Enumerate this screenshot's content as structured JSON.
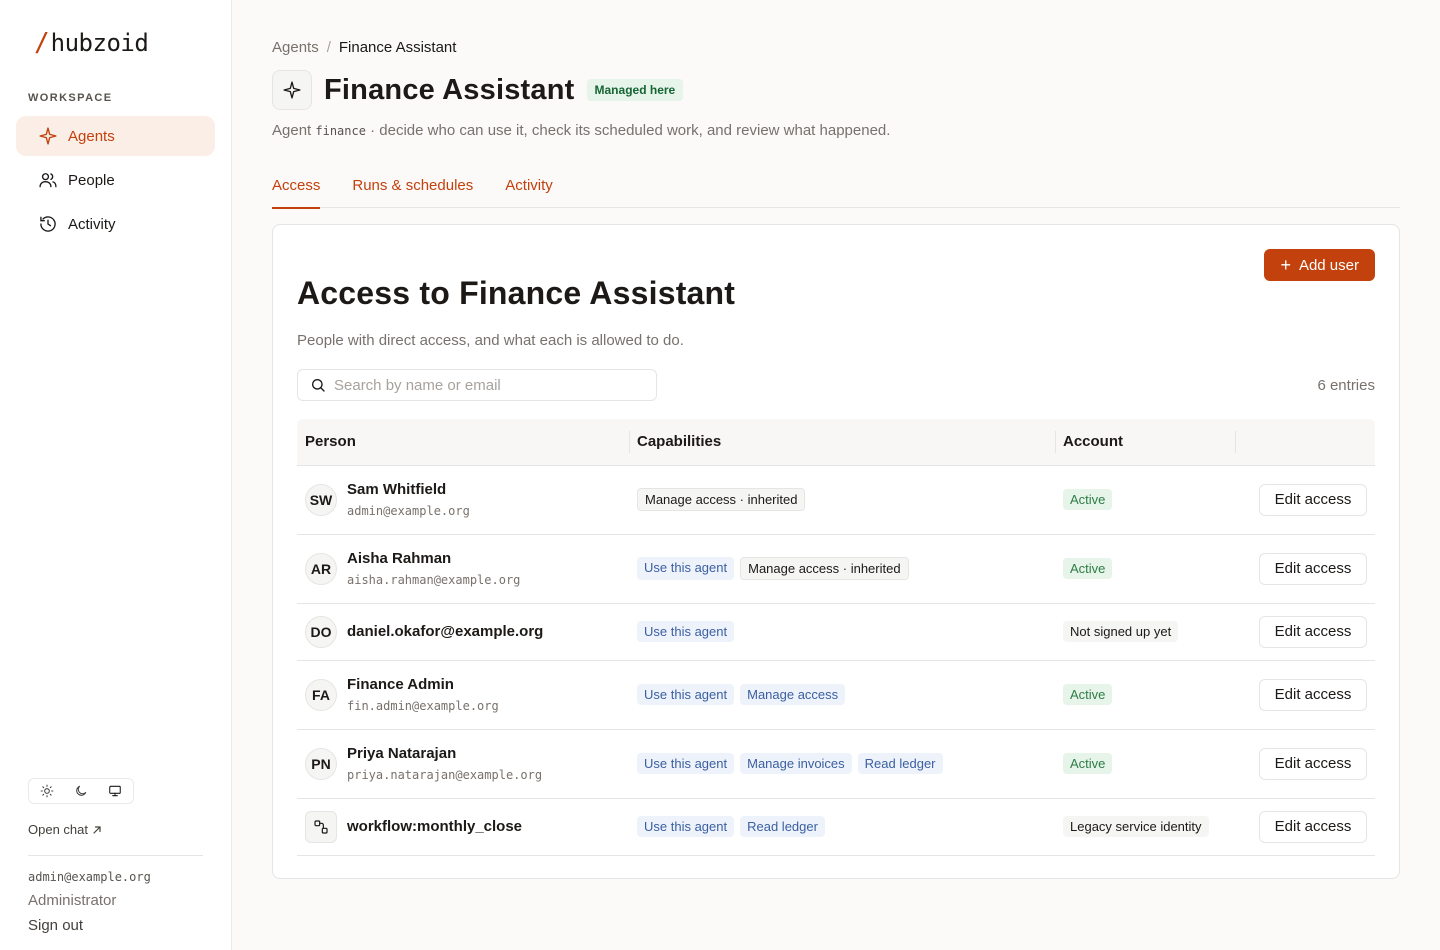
{
  "brand": {
    "slash": "/",
    "name": "hubzoid",
    "accent": "#c2410c"
  },
  "sidebar": {
    "section_label": "WORKSPACE",
    "items": [
      {
        "label": "Agents",
        "icon": "sparkle-icon",
        "active": true
      },
      {
        "label": "People",
        "icon": "users-icon",
        "active": false
      },
      {
        "label": "Activity",
        "icon": "history-icon",
        "active": false
      }
    ],
    "theme_options": [
      "light",
      "dark",
      "system"
    ],
    "open_chat": "Open chat",
    "user_email": "admin@example.org",
    "user_role": "Administrator",
    "sign_out": "Sign out"
  },
  "breadcrumb": {
    "parent": "Agents",
    "separator": "/",
    "current": "Finance Assistant"
  },
  "header": {
    "title": "Finance Assistant",
    "badge": "Managed here",
    "subtitle_prefix": "Agent",
    "agent_id": "finance",
    "subtitle_suffix": "· decide who can use it, check its scheduled work, and review what happened."
  },
  "tabs": [
    {
      "label": "Access",
      "active": true
    },
    {
      "label": "Runs & schedules",
      "active": false
    },
    {
      "label": "Activity",
      "active": false
    }
  ],
  "card": {
    "title": "Access to Finance Assistant",
    "subtitle": "People with direct access, and what each is allowed to do.",
    "add_button": "Add user",
    "search_placeholder": "Search by name or email",
    "entries": "6 entries"
  },
  "table": {
    "columns": [
      "Person",
      "Capabilities",
      "Account",
      ""
    ],
    "action_label": "Edit access",
    "rows": [
      {
        "initials": "SW",
        "name": "Sam Whitfield",
        "email": "admin@example.org",
        "caps": [
          {
            "label": "Manage access · inherited",
            "style": "gray"
          }
        ],
        "account": "Active",
        "account_style": "active"
      },
      {
        "initials": "AR",
        "name": "Aisha Rahman",
        "email": "aisha.rahman@example.org",
        "caps": [
          {
            "label": "Use this agent",
            "style": "blue"
          },
          {
            "label": "Manage access · inherited",
            "style": "gray"
          }
        ],
        "account": "Active",
        "account_style": "active"
      },
      {
        "initials": "DO",
        "name": "daniel.okafor@example.org",
        "email": "",
        "caps": [
          {
            "label": "Use this agent",
            "style": "blue"
          }
        ],
        "account": "Not signed up yet",
        "account_style": "neutral"
      },
      {
        "initials": "FA",
        "name": "Finance Admin",
        "email": "fin.admin@example.org",
        "caps": [
          {
            "label": "Use this agent",
            "style": "blue"
          },
          {
            "label": "Manage access",
            "style": "blue"
          }
        ],
        "account": "Active",
        "account_style": "active"
      },
      {
        "initials": "PN",
        "name": "Priya Natarajan",
        "email": "priya.natarajan@example.org",
        "caps": [
          {
            "label": "Use this agent",
            "style": "blue"
          },
          {
            "label": "Manage invoices",
            "style": "blue"
          },
          {
            "label": "Read ledger",
            "style": "blue"
          }
        ],
        "account": "Active",
        "account_style": "active"
      },
      {
        "initials": "",
        "icon": "workflow-icon",
        "name": "workflow:monthly_close",
        "email": "",
        "caps": [
          {
            "label": "Use this agent",
            "style": "blue"
          },
          {
            "label": "Read ledger",
            "style": "blue"
          }
        ],
        "account": "Legacy service identity",
        "account_style": "neutral"
      }
    ]
  }
}
